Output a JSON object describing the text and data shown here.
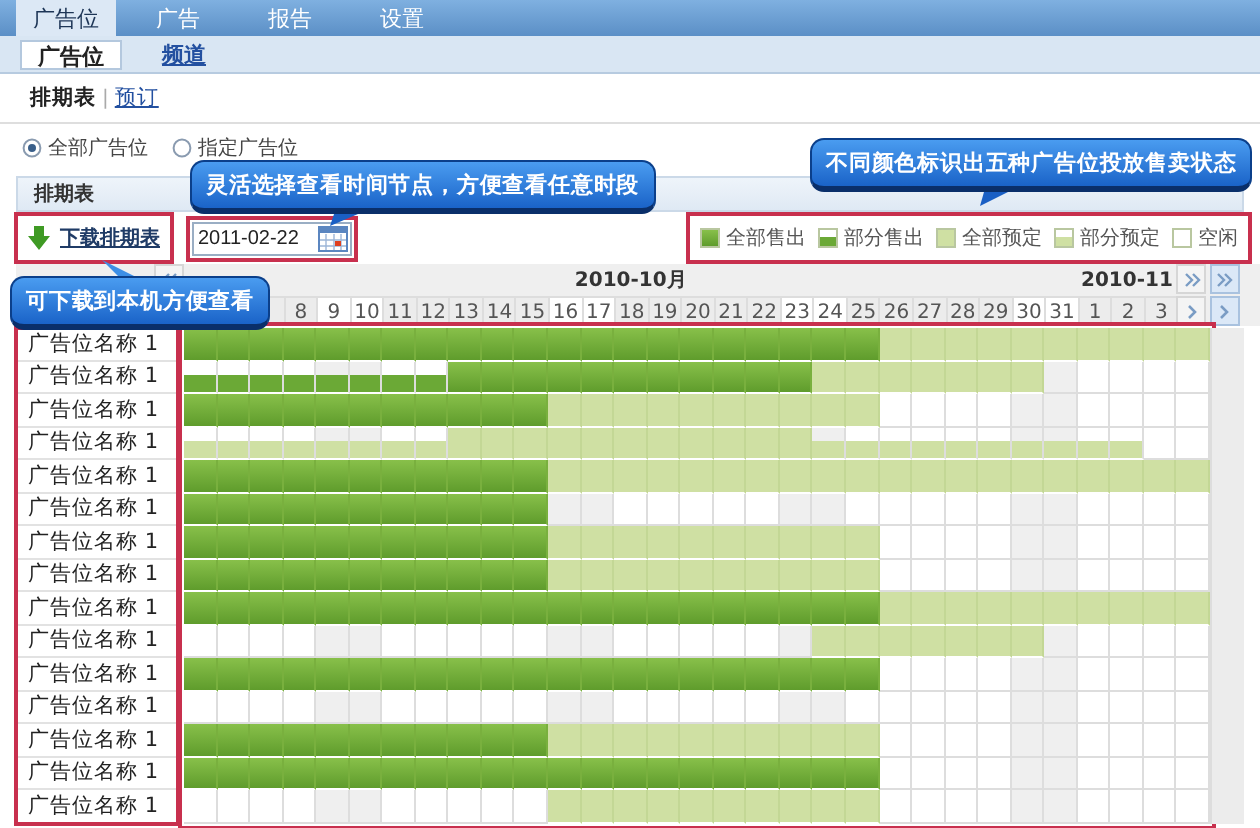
{
  "top_tabs": [
    {
      "label": "广告位",
      "selected": true
    },
    {
      "label": "广告",
      "selected": false
    },
    {
      "label": "报告",
      "selected": false
    },
    {
      "label": "设置",
      "selected": false
    }
  ],
  "sub_tabs": [
    {
      "label": "广告位",
      "selected": true
    },
    {
      "label": "频道",
      "selected": false
    }
  ],
  "page_tabs": [
    {
      "label": "排期表",
      "selected": true
    },
    {
      "label": "预订",
      "selected": false
    }
  ],
  "page_tab_separator": "|",
  "scope_options": [
    {
      "label": "全部广告位",
      "selected": true
    },
    {
      "label": "指定广告位",
      "selected": false
    }
  ],
  "section_title": "排期表",
  "download": {
    "label": "下载排期表",
    "highlight": true
  },
  "date_field": {
    "value": "2011-02-22",
    "highlight": true
  },
  "legend": {
    "highlight": true,
    "items": [
      {
        "kind": "sold",
        "label": "全部售出"
      },
      {
        "kind": "part_sold",
        "label": "部分售出"
      },
      {
        "kind": "booked",
        "label": "全部预定"
      },
      {
        "kind": "part_booked",
        "label": "部分预定"
      },
      {
        "kind": "free",
        "label": "空闲"
      }
    ]
  },
  "schedule": {
    "highlight": true,
    "months": [
      {
        "label": "2010-10月",
        "days": [
          {
            "label": "8",
            "weekend": false
          },
          {
            "label": "9",
            "weekend": true
          },
          {
            "label": "10",
            "weekend": true
          },
          {
            "label": "11",
            "weekend": false
          },
          {
            "label": "12",
            "weekend": false
          },
          {
            "label": "13",
            "weekend": false
          },
          {
            "label": "14",
            "weekend": false
          },
          {
            "label": "15",
            "weekend": false
          },
          {
            "label": "16",
            "weekend": true
          },
          {
            "label": "17",
            "weekend": true
          },
          {
            "label": "18",
            "weekend": false
          },
          {
            "label": "19",
            "weekend": false
          },
          {
            "label": "20",
            "weekend": false
          },
          {
            "label": "21",
            "weekend": false
          },
          {
            "label": "22",
            "weekend": false
          },
          {
            "label": "23",
            "weekend": true
          },
          {
            "label": "24",
            "weekend": true
          },
          {
            "label": "25",
            "weekend": false
          },
          {
            "label": "26",
            "weekend": false
          },
          {
            "label": "27",
            "weekend": false
          },
          {
            "label": "28",
            "weekend": false
          },
          {
            "label": "29",
            "weekend": false
          },
          {
            "label": "30",
            "weekend": true
          },
          {
            "label": "31",
            "weekend": true
          }
        ]
      },
      {
        "label": "2010-11",
        "days": [
          {
            "label": "1",
            "weekend": false
          },
          {
            "label": "2",
            "weekend": false
          },
          {
            "label": "3",
            "weekend": false
          }
        ]
      }
    ],
    "rows": [
      {
        "name": "广告位名称 1",
        "cells": [
          {
            "kind": "sold"
          },
          {
            "kind": "sold"
          },
          {
            "kind": "sold"
          },
          {
            "kind": "sold"
          },
          {
            "kind": "sold"
          },
          {
            "kind": "sold"
          },
          {
            "kind": "sold"
          },
          {
            "kind": "sold"
          },
          {
            "kind": "sold"
          },
          {
            "kind": "sold"
          },
          {
            "kind": "sold"
          },
          {
            "kind": "sold"
          },
          {
            "kind": "sold"
          },
          {
            "kind": "sold"
          },
          {
            "kind": "sold"
          },
          {
            "kind": "sold"
          },
          {
            "kind": "sold"
          },
          {
            "kind": "sold"
          },
          {
            "kind": "sold"
          },
          {
            "kind": "sold"
          },
          {
            "kind": "sold"
          },
          {
            "kind": "booked"
          },
          {
            "kind": "booked"
          },
          {
            "kind": "booked"
          },
          {
            "kind": "booked"
          },
          {
            "kind": "booked"
          },
          {
            "kind": "booked"
          },
          {
            "kind": "booked"
          },
          {
            "kind": "booked"
          },
          {
            "kind": "booked"
          },
          {
            "kind": "booked"
          }
        ]
      },
      {
        "name": "广告位名称 1",
        "cells": [
          {
            "kind": "part_sold"
          },
          {
            "kind": "part_sold"
          },
          {
            "kind": "part_sold"
          },
          {
            "kind": "part_sold"
          },
          {
            "kind": "part_sold"
          },
          {
            "kind": "part_sold"
          },
          {
            "kind": "part_sold"
          },
          {
            "kind": "part_sold"
          },
          {
            "kind": "sold"
          },
          {
            "kind": "sold"
          },
          {
            "kind": "sold"
          },
          {
            "kind": "sold"
          },
          {
            "kind": "sold"
          },
          {
            "kind": "sold"
          },
          {
            "kind": "sold"
          },
          {
            "kind": "sold"
          },
          {
            "kind": "sold"
          },
          {
            "kind": "sold"
          },
          {
            "kind": "sold"
          },
          {
            "kind": "booked"
          },
          {
            "kind": "booked"
          },
          {
            "kind": "booked"
          },
          {
            "kind": "booked"
          },
          {
            "kind": "booked"
          },
          {
            "kind": "booked"
          },
          {
            "kind": "booked"
          },
          {
            "kind": "free"
          },
          {
            "kind": "free"
          },
          {
            "kind": "free"
          },
          {
            "kind": "free"
          },
          {
            "kind": "free"
          }
        ]
      },
      {
        "name": "广告位名称 1",
        "cells": [
          {
            "kind": "sold"
          },
          {
            "kind": "sold"
          },
          {
            "kind": "sold"
          },
          {
            "kind": "sold"
          },
          {
            "kind": "sold"
          },
          {
            "kind": "sold"
          },
          {
            "kind": "sold"
          },
          {
            "kind": "sold"
          },
          {
            "kind": "sold"
          },
          {
            "kind": "sold"
          },
          {
            "kind": "sold"
          },
          {
            "kind": "booked"
          },
          {
            "kind": "booked"
          },
          {
            "kind": "booked"
          },
          {
            "kind": "booked"
          },
          {
            "kind": "booked"
          },
          {
            "kind": "booked"
          },
          {
            "kind": "booked"
          },
          {
            "kind": "booked"
          },
          {
            "kind": "booked"
          },
          {
            "kind": "booked"
          },
          {
            "kind": "free"
          },
          {
            "kind": "free"
          },
          {
            "kind": "free"
          },
          {
            "kind": "free"
          },
          {
            "kind": "free"
          },
          {
            "kind": "free"
          },
          {
            "kind": "free"
          },
          {
            "kind": "free"
          },
          {
            "kind": "free"
          },
          {
            "kind": "free"
          }
        ]
      },
      {
        "name": "广告位名称 1",
        "cells": [
          {
            "kind": "part_booked"
          },
          {
            "kind": "part_booked"
          },
          {
            "kind": "part_booked"
          },
          {
            "kind": "part_booked"
          },
          {
            "kind": "part_booked"
          },
          {
            "kind": "part_booked"
          },
          {
            "kind": "part_booked"
          },
          {
            "kind": "part_booked"
          },
          {
            "kind": "booked"
          },
          {
            "kind": "booked"
          },
          {
            "kind": "booked"
          },
          {
            "kind": "booked"
          },
          {
            "kind": "booked"
          },
          {
            "kind": "booked"
          },
          {
            "kind": "booked"
          },
          {
            "kind": "booked"
          },
          {
            "kind": "booked"
          },
          {
            "kind": "booked"
          },
          {
            "kind": "booked"
          },
          {
            "kind": "part_booked"
          },
          {
            "kind": "part_booked"
          },
          {
            "kind": "part_booked"
          },
          {
            "kind": "part_booked"
          },
          {
            "kind": "part_booked"
          },
          {
            "kind": "part_booked"
          },
          {
            "kind": "part_booked"
          },
          {
            "kind": "part_booked"
          },
          {
            "kind": "part_booked"
          },
          {
            "kind": "part_booked"
          },
          {
            "kind": "free"
          },
          {
            "kind": "free"
          }
        ]
      },
      {
        "name": "广告位名称 1",
        "cells": [
          {
            "kind": "sold"
          },
          {
            "kind": "sold"
          },
          {
            "kind": "sold"
          },
          {
            "kind": "sold"
          },
          {
            "kind": "sold"
          },
          {
            "kind": "sold"
          },
          {
            "kind": "sold"
          },
          {
            "kind": "sold"
          },
          {
            "kind": "sold"
          },
          {
            "kind": "sold"
          },
          {
            "kind": "sold"
          },
          {
            "kind": "booked"
          },
          {
            "kind": "booked"
          },
          {
            "kind": "booked"
          },
          {
            "kind": "booked"
          },
          {
            "kind": "booked"
          },
          {
            "kind": "booked"
          },
          {
            "kind": "booked"
          },
          {
            "kind": "booked"
          },
          {
            "kind": "booked"
          },
          {
            "kind": "booked"
          },
          {
            "kind": "booked"
          },
          {
            "kind": "booked"
          },
          {
            "kind": "booked"
          },
          {
            "kind": "booked"
          },
          {
            "kind": "booked"
          },
          {
            "kind": "booked"
          },
          {
            "kind": "booked"
          },
          {
            "kind": "booked"
          },
          {
            "kind": "booked"
          },
          {
            "kind": "booked"
          }
        ]
      },
      {
        "name": "广告位名称 1",
        "cells": [
          {
            "kind": "sold"
          },
          {
            "kind": "sold"
          },
          {
            "kind": "sold"
          },
          {
            "kind": "sold"
          },
          {
            "kind": "sold"
          },
          {
            "kind": "sold"
          },
          {
            "kind": "sold"
          },
          {
            "kind": "sold"
          },
          {
            "kind": "sold"
          },
          {
            "kind": "sold"
          },
          {
            "kind": "sold"
          },
          {
            "kind": "free"
          },
          {
            "kind": "free"
          },
          {
            "kind": "free"
          },
          {
            "kind": "free"
          },
          {
            "kind": "free"
          },
          {
            "kind": "free"
          },
          {
            "kind": "free"
          },
          {
            "kind": "free"
          },
          {
            "kind": "free"
          },
          {
            "kind": "free"
          },
          {
            "kind": "free"
          },
          {
            "kind": "free"
          },
          {
            "kind": "free"
          },
          {
            "kind": "free"
          },
          {
            "kind": "free"
          },
          {
            "kind": "free"
          },
          {
            "kind": "free"
          },
          {
            "kind": "free"
          },
          {
            "kind": "free"
          },
          {
            "kind": "free"
          }
        ]
      },
      {
        "name": "广告位名称 1",
        "cells": [
          {
            "kind": "sold"
          },
          {
            "kind": "sold"
          },
          {
            "kind": "sold"
          },
          {
            "kind": "sold"
          },
          {
            "kind": "sold"
          },
          {
            "kind": "sold"
          },
          {
            "kind": "sold"
          },
          {
            "kind": "sold"
          },
          {
            "kind": "sold"
          },
          {
            "kind": "sold"
          },
          {
            "kind": "sold"
          },
          {
            "kind": "booked"
          },
          {
            "kind": "booked"
          },
          {
            "kind": "booked"
          },
          {
            "kind": "booked"
          },
          {
            "kind": "booked"
          },
          {
            "kind": "booked"
          },
          {
            "kind": "booked"
          },
          {
            "kind": "booked"
          },
          {
            "kind": "booked"
          },
          {
            "kind": "booked"
          },
          {
            "kind": "free"
          },
          {
            "kind": "free"
          },
          {
            "kind": "free"
          },
          {
            "kind": "free"
          },
          {
            "kind": "free"
          },
          {
            "kind": "free"
          },
          {
            "kind": "free"
          },
          {
            "kind": "free"
          },
          {
            "kind": "free"
          },
          {
            "kind": "free"
          }
        ]
      },
      {
        "name": "广告位名称 1",
        "cells": [
          {
            "kind": "sold"
          },
          {
            "kind": "sold"
          },
          {
            "kind": "sold"
          },
          {
            "kind": "sold"
          },
          {
            "kind": "sold"
          },
          {
            "kind": "sold"
          },
          {
            "kind": "sold"
          },
          {
            "kind": "sold"
          },
          {
            "kind": "sold"
          },
          {
            "kind": "sold"
          },
          {
            "kind": "sold"
          },
          {
            "kind": "booked"
          },
          {
            "kind": "booked"
          },
          {
            "kind": "booked"
          },
          {
            "kind": "booked"
          },
          {
            "kind": "booked"
          },
          {
            "kind": "booked"
          },
          {
            "kind": "booked"
          },
          {
            "kind": "booked"
          },
          {
            "kind": "booked"
          },
          {
            "kind": "booked"
          },
          {
            "kind": "free"
          },
          {
            "kind": "free"
          },
          {
            "kind": "free"
          },
          {
            "kind": "free"
          },
          {
            "kind": "free"
          },
          {
            "kind": "free"
          },
          {
            "kind": "free"
          },
          {
            "kind": "free"
          },
          {
            "kind": "free"
          },
          {
            "kind": "free"
          }
        ]
      },
      {
        "name": "广告位名称 1",
        "cells": [
          {
            "kind": "sold"
          },
          {
            "kind": "sold"
          },
          {
            "kind": "sold"
          },
          {
            "kind": "sold"
          },
          {
            "kind": "sold"
          },
          {
            "kind": "sold"
          },
          {
            "kind": "sold"
          },
          {
            "kind": "sold"
          },
          {
            "kind": "sold"
          },
          {
            "kind": "sold"
          },
          {
            "kind": "sold"
          },
          {
            "kind": "sold"
          },
          {
            "kind": "sold"
          },
          {
            "kind": "sold"
          },
          {
            "kind": "sold"
          },
          {
            "kind": "sold"
          },
          {
            "kind": "sold"
          },
          {
            "kind": "sold"
          },
          {
            "kind": "sold"
          },
          {
            "kind": "sold"
          },
          {
            "kind": "sold"
          },
          {
            "kind": "booked"
          },
          {
            "kind": "booked"
          },
          {
            "kind": "booked"
          },
          {
            "kind": "booked"
          },
          {
            "kind": "booked"
          },
          {
            "kind": "booked"
          },
          {
            "kind": "booked"
          },
          {
            "kind": "booked"
          },
          {
            "kind": "booked"
          },
          {
            "kind": "booked"
          }
        ]
      },
      {
        "name": "广告位名称 1",
        "cells": [
          {
            "kind": "free"
          },
          {
            "kind": "free"
          },
          {
            "kind": "free"
          },
          {
            "kind": "free"
          },
          {
            "kind": "free"
          },
          {
            "kind": "free"
          },
          {
            "kind": "free"
          },
          {
            "kind": "free"
          },
          {
            "kind": "free"
          },
          {
            "kind": "free"
          },
          {
            "kind": "free"
          },
          {
            "kind": "free"
          },
          {
            "kind": "free"
          },
          {
            "kind": "free"
          },
          {
            "kind": "free"
          },
          {
            "kind": "free"
          },
          {
            "kind": "free"
          },
          {
            "kind": "free"
          },
          {
            "kind": "free"
          },
          {
            "kind": "booked"
          },
          {
            "kind": "booked"
          },
          {
            "kind": "booked"
          },
          {
            "kind": "booked"
          },
          {
            "kind": "booked"
          },
          {
            "kind": "booked"
          },
          {
            "kind": "booked"
          },
          {
            "kind": "free"
          },
          {
            "kind": "free"
          },
          {
            "kind": "free"
          },
          {
            "kind": "free"
          },
          {
            "kind": "free"
          }
        ]
      },
      {
        "name": "广告位名称 1",
        "cells": [
          {
            "kind": "sold"
          },
          {
            "kind": "sold"
          },
          {
            "kind": "sold"
          },
          {
            "kind": "sold"
          },
          {
            "kind": "sold"
          },
          {
            "kind": "sold"
          },
          {
            "kind": "sold"
          },
          {
            "kind": "sold"
          },
          {
            "kind": "sold"
          },
          {
            "kind": "sold"
          },
          {
            "kind": "sold"
          },
          {
            "kind": "sold"
          },
          {
            "kind": "sold"
          },
          {
            "kind": "sold"
          },
          {
            "kind": "sold"
          },
          {
            "kind": "sold"
          },
          {
            "kind": "sold"
          },
          {
            "kind": "sold"
          },
          {
            "kind": "sold"
          },
          {
            "kind": "sold"
          },
          {
            "kind": "sold"
          },
          {
            "kind": "free"
          },
          {
            "kind": "free"
          },
          {
            "kind": "free"
          },
          {
            "kind": "free"
          },
          {
            "kind": "free"
          },
          {
            "kind": "free"
          },
          {
            "kind": "free"
          },
          {
            "kind": "free"
          },
          {
            "kind": "free"
          },
          {
            "kind": "free"
          }
        ]
      },
      {
        "name": "广告位名称 1",
        "cells": [
          {
            "kind": "free"
          },
          {
            "kind": "free"
          },
          {
            "kind": "free"
          },
          {
            "kind": "free"
          },
          {
            "kind": "free"
          },
          {
            "kind": "free"
          },
          {
            "kind": "free"
          },
          {
            "kind": "free"
          },
          {
            "kind": "free"
          },
          {
            "kind": "free"
          },
          {
            "kind": "free"
          },
          {
            "kind": "free"
          },
          {
            "kind": "free"
          },
          {
            "kind": "free"
          },
          {
            "kind": "free"
          },
          {
            "kind": "free"
          },
          {
            "kind": "free"
          },
          {
            "kind": "free"
          },
          {
            "kind": "free"
          },
          {
            "kind": "free"
          },
          {
            "kind": "free"
          },
          {
            "kind": "free"
          },
          {
            "kind": "free"
          },
          {
            "kind": "free"
          },
          {
            "kind": "free"
          },
          {
            "kind": "free"
          },
          {
            "kind": "free"
          },
          {
            "kind": "free"
          },
          {
            "kind": "free"
          },
          {
            "kind": "free"
          },
          {
            "kind": "free"
          }
        ]
      },
      {
        "name": "广告位名称 1",
        "cells": [
          {
            "kind": "sold"
          },
          {
            "kind": "sold"
          },
          {
            "kind": "sold"
          },
          {
            "kind": "sold"
          },
          {
            "kind": "sold"
          },
          {
            "kind": "sold"
          },
          {
            "kind": "sold"
          },
          {
            "kind": "sold"
          },
          {
            "kind": "sold"
          },
          {
            "kind": "sold"
          },
          {
            "kind": "sold"
          },
          {
            "kind": "booked"
          },
          {
            "kind": "booked"
          },
          {
            "kind": "booked"
          },
          {
            "kind": "booked"
          },
          {
            "kind": "booked"
          },
          {
            "kind": "booked"
          },
          {
            "kind": "booked"
          },
          {
            "kind": "booked"
          },
          {
            "kind": "booked"
          },
          {
            "kind": "booked"
          },
          {
            "kind": "free"
          },
          {
            "kind": "free"
          },
          {
            "kind": "free"
          },
          {
            "kind": "free"
          },
          {
            "kind": "free"
          },
          {
            "kind": "free"
          },
          {
            "kind": "free"
          },
          {
            "kind": "free"
          },
          {
            "kind": "free"
          },
          {
            "kind": "free"
          }
        ]
      },
      {
        "name": "广告位名称 1",
        "cells": [
          {
            "kind": "sold"
          },
          {
            "kind": "sold"
          },
          {
            "kind": "sold"
          },
          {
            "kind": "sold"
          },
          {
            "kind": "sold"
          },
          {
            "kind": "sold"
          },
          {
            "kind": "sold"
          },
          {
            "kind": "sold"
          },
          {
            "kind": "sold"
          },
          {
            "kind": "sold"
          },
          {
            "kind": "sold"
          },
          {
            "kind": "sold"
          },
          {
            "kind": "sold"
          },
          {
            "kind": "sold"
          },
          {
            "kind": "sold"
          },
          {
            "kind": "sold"
          },
          {
            "kind": "sold"
          },
          {
            "kind": "sold"
          },
          {
            "kind": "sold"
          },
          {
            "kind": "sold"
          },
          {
            "kind": "sold"
          },
          {
            "kind": "free"
          },
          {
            "kind": "free"
          },
          {
            "kind": "free"
          },
          {
            "kind": "free"
          },
          {
            "kind": "free"
          },
          {
            "kind": "free"
          },
          {
            "kind": "free"
          },
          {
            "kind": "free"
          },
          {
            "kind": "free"
          },
          {
            "kind": "free"
          }
        ]
      },
      {
        "name": "广告位名称 1",
        "cells": [
          {
            "kind": "free"
          },
          {
            "kind": "free"
          },
          {
            "kind": "free"
          },
          {
            "kind": "free"
          },
          {
            "kind": "free"
          },
          {
            "kind": "free"
          },
          {
            "kind": "free"
          },
          {
            "kind": "free"
          },
          {
            "kind": "free"
          },
          {
            "kind": "free"
          },
          {
            "kind": "free"
          },
          {
            "kind": "booked"
          },
          {
            "kind": "booked"
          },
          {
            "kind": "booked"
          },
          {
            "kind": "booked"
          },
          {
            "kind": "booked"
          },
          {
            "kind": "booked"
          },
          {
            "kind": "booked"
          },
          {
            "kind": "booked"
          },
          {
            "kind": "booked"
          },
          {
            "kind": "booked"
          },
          {
            "kind": "free"
          },
          {
            "kind": "free"
          },
          {
            "kind": "free"
          },
          {
            "kind": "free"
          },
          {
            "kind": "free"
          },
          {
            "kind": "free"
          },
          {
            "kind": "free"
          },
          {
            "kind": "free"
          },
          {
            "kind": "free"
          },
          {
            "kind": "free"
          }
        ]
      }
    ]
  },
  "annotations": [
    {
      "kind": "date_field",
      "text": "灵活选择查看时间节点，方便查看任意时段"
    },
    {
      "kind": "legend",
      "text": "不同颜色标识出五种广告位投放售卖状态"
    },
    {
      "kind": "download",
      "text": "可下载到本机方便查看"
    }
  ]
}
